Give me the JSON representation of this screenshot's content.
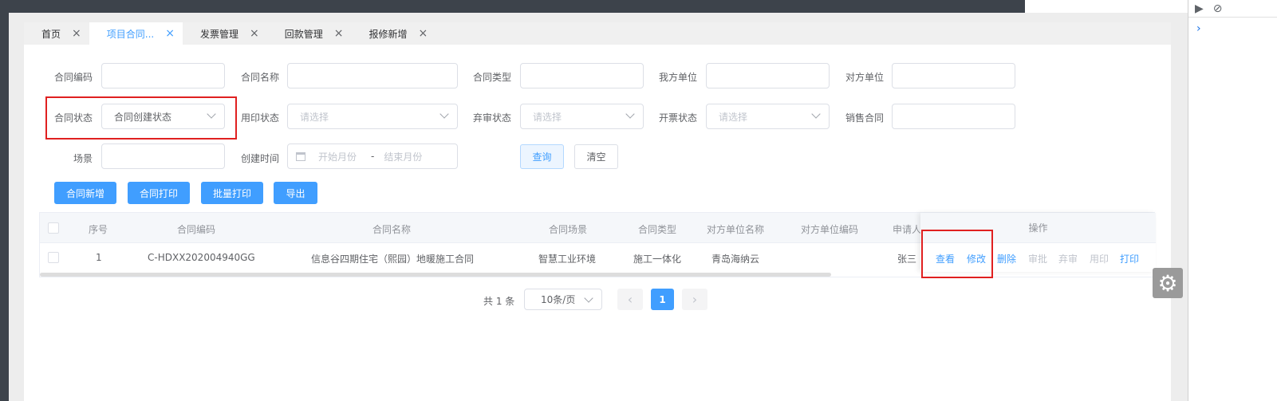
{
  "tabs": [
    {
      "label": "首页"
    },
    {
      "label": "项目合同..."
    },
    {
      "label": "发票管理"
    },
    {
      "label": "回款管理"
    },
    {
      "label": "报修新增"
    }
  ],
  "filters": {
    "contract_code": "合同编码",
    "contract_name": "合同名称",
    "contract_type": "合同类型",
    "our_unit": "我方单位",
    "counter_unit": "对方单位",
    "contract_status": "合同状态",
    "contract_status_value": "合同创建状态",
    "seal_status": "用印状态",
    "abandon_status": "弃审状态",
    "invoice_status": "开票状态",
    "sales_contract": "销售合同",
    "scene": "场景",
    "create_time": "创建时间",
    "select_placeholder": "请选择",
    "start_month": "开始月份",
    "end_month": "结束月份",
    "range_sep": "-",
    "query": "查询",
    "clear": "清空"
  },
  "actions": {
    "add": "合同新增",
    "print": "合同打印",
    "batch_print": "批量打印",
    "export": "导出"
  },
  "table": {
    "headers": {
      "index": "序号",
      "code": "合同编码",
      "name": "合同名称",
      "scene": "合同场景",
      "type": "合同类型",
      "counter_name": "对方单位名称",
      "counter_code": "对方单位编码",
      "applicant": "申请人",
      "ops": "操作"
    },
    "rows": [
      {
        "index": "1",
        "code": "C-HDXX202004940GG",
        "name": "信息谷四期住宅（熙园）地暖施工合同",
        "scene": "智慧工业环境",
        "type": "施工一体化",
        "counter_name": "青岛海纳云",
        "counter_code": "",
        "applicant": "张三",
        "ops": {
          "view": "查看",
          "edit": "修改",
          "delete": "删除",
          "approve": "审批",
          "abandon": "弃审",
          "seal": "用印",
          "print": "打印"
        }
      }
    ]
  },
  "pagination": {
    "total": "共 1 条",
    "page_size": "10条/页",
    "current": "1",
    "prev": "‹",
    "next": "›"
  },
  "colors": {
    "primary": "#409eff",
    "highlight_box": "#e02020",
    "sidebar": "#3d434b"
  }
}
